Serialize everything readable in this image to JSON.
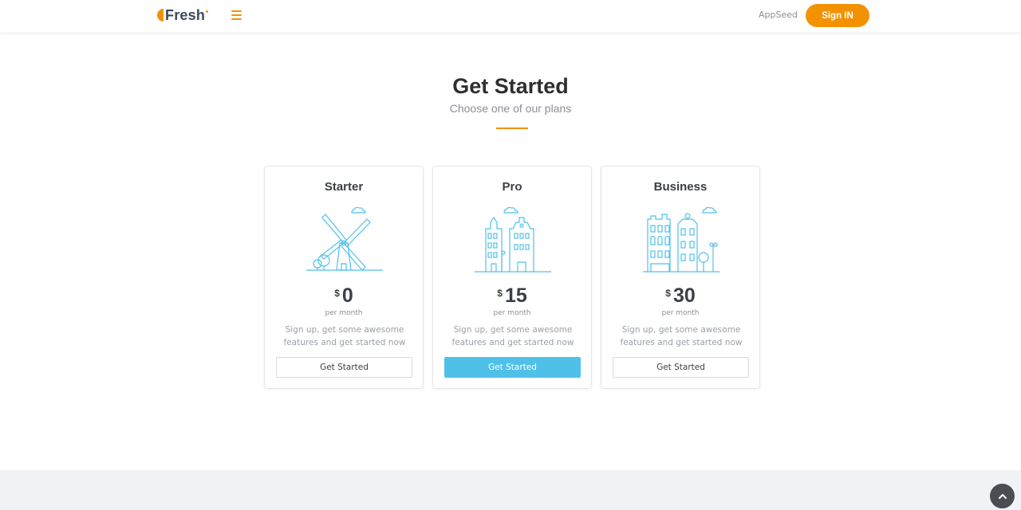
{
  "navbar": {
    "logo_text": "Fresh",
    "menu_icon": "hamburger-menu-icon",
    "link_label": "AppSeed",
    "signin_label": "Sign IN"
  },
  "colors": {
    "accent": "#f39200",
    "primary_button": "#4fc1e9",
    "heading": "#2f2f2f",
    "muted": "#8a8f96",
    "footer_band": "#eff3f6"
  },
  "section": {
    "title": "Get Started",
    "subtitle": "Choose one of our plans"
  },
  "plans": [
    {
      "name": "Starter",
      "illustration": "windmill-illustration",
      "currency": "$",
      "price": "0",
      "period": "per month",
      "description": "Sign up, get some awesome features and get started now",
      "button_label": "Get Started",
      "highlighted": false
    },
    {
      "name": "Pro",
      "illustration": "townhouses-illustration",
      "currency": "$",
      "price": "15",
      "period": "per month",
      "description": "Sign up, get some awesome features and get started now",
      "button_label": "Get Started",
      "highlighted": true
    },
    {
      "name": "Business",
      "illustration": "city-buildings-illustration",
      "currency": "$",
      "price": "30",
      "period": "per month",
      "description": "Sign up, get some awesome features and get started now",
      "button_label": "Get Started",
      "highlighted": false
    }
  ],
  "back_to_top_icon": "chevron-up-icon"
}
